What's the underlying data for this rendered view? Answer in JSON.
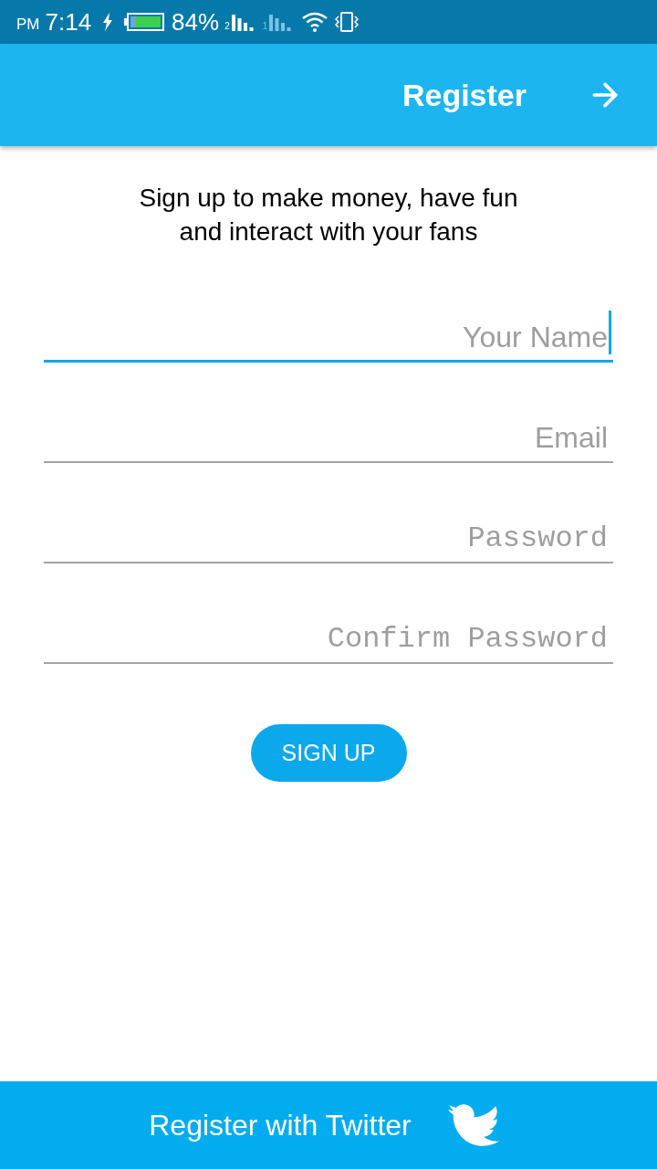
{
  "status_bar": {
    "period": "PM",
    "time": "7:14",
    "battery_percent": "84%",
    "signals": [
      {
        "sim": "2",
        "active": true
      },
      {
        "sim": "1",
        "active": false
      }
    ]
  },
  "app_bar": {
    "title": "Register"
  },
  "intro": "Sign up to make money, have fun and interact with your fans",
  "fields": [
    {
      "kind": "text",
      "placeholder": "Your Name",
      "focused": true
    },
    {
      "kind": "email",
      "placeholder": "Email",
      "focused": false
    },
    {
      "kind": "password",
      "placeholder": "Password",
      "focused": false
    },
    {
      "kind": "password",
      "placeholder": "Confirm Password",
      "focused": false
    }
  ],
  "sign_up_button": {
    "label": "SIGN UP"
  },
  "twitter_button": {
    "label": "Register with Twitter"
  }
}
